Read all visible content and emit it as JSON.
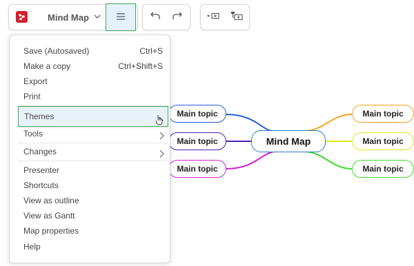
{
  "toolbar": {
    "title": "Mind Map",
    "icons": {
      "logo": "mindmap-logo-icon",
      "chevron": "chevron-down-icon",
      "menu": "hamburger-menu-icon",
      "undo": "undo-icon",
      "redo": "redo-icon",
      "insert_sibling": "insert-sibling-icon",
      "insert_child": "insert-child-icon"
    }
  },
  "menu": {
    "items": [
      {
        "label": "Save (Autosaved)",
        "shortcut": "Ctrl+S"
      },
      {
        "label": "Make a copy",
        "shortcut": "Ctrl+Shift+S"
      },
      {
        "label": "Export"
      },
      {
        "label": "Print"
      },
      {
        "label": "Themes",
        "submenu": true,
        "active": true
      },
      {
        "label": "Tools",
        "submenu": true
      },
      {
        "label": "Changes",
        "submenu": true
      },
      {
        "label": "Presenter"
      },
      {
        "label": "Shortcuts"
      },
      {
        "label": "View as outline"
      },
      {
        "label": "View as Gantt"
      },
      {
        "label": "Map properties"
      },
      {
        "label": "Help"
      }
    ]
  },
  "mindmap": {
    "center": "Mind Map",
    "left_topics": [
      "Main topic",
      "Main topic",
      "Main topic"
    ],
    "right_topics": [
      "Main topic",
      "Main topic",
      "Main topic"
    ],
    "colors": {
      "center": "#2a7bd0",
      "left": [
        "#1f5fd6",
        "#4a1fb0",
        "#d21fd2"
      ],
      "right": [
        "#f5a020",
        "#d8e81a",
        "#3ddc2a"
      ]
    }
  },
  "accent": "#3fa34d"
}
